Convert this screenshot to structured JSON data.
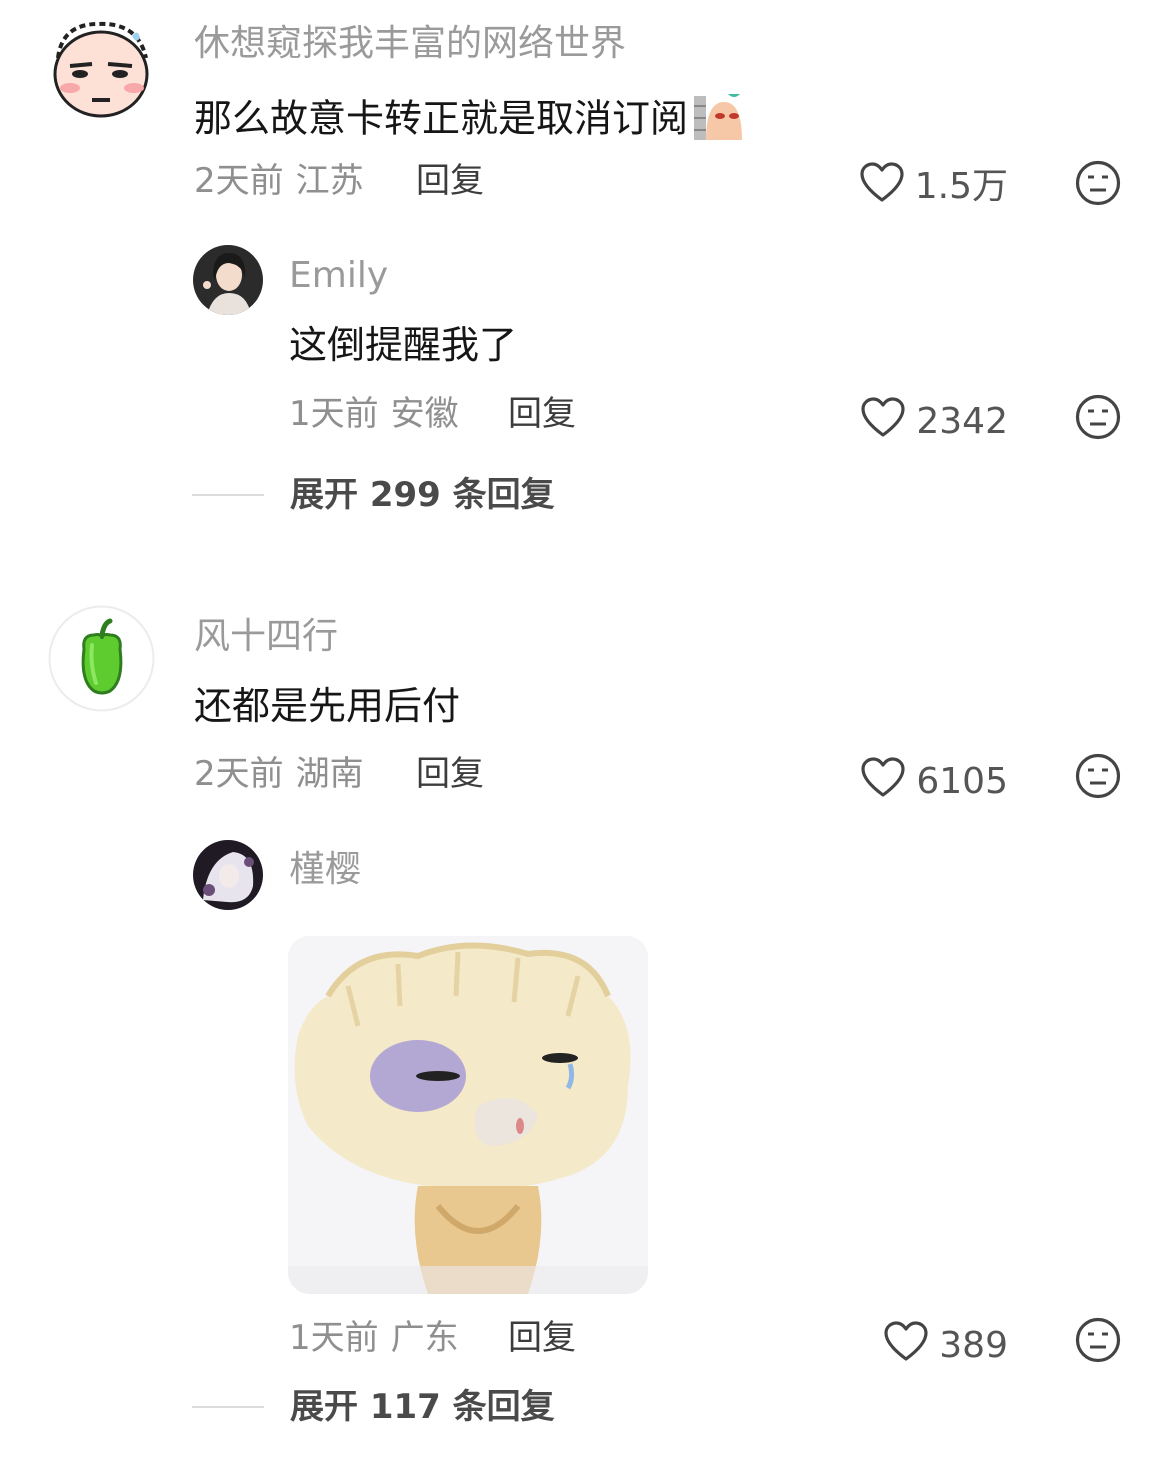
{
  "comments": [
    {
      "username": "休想窥探我丰富的网络世界",
      "text": "那么故意卡转正就是取消订阅",
      "time": "2天前",
      "location": "江苏",
      "reply_label": "回复",
      "likes": "1.5万",
      "replies": [
        {
          "username": "Emily",
          "text": "这倒提醒我了",
          "time": "1天前",
          "location": "安徽",
          "reply_label": "回复",
          "likes": "2342"
        }
      ],
      "expand_label": "展开 299 条回复"
    },
    {
      "username": "风十四行",
      "text": "还都是先用后付",
      "time": "2天前",
      "location": "湖南",
      "reply_label": "回复",
      "likes": "6105",
      "replies": [
        {
          "username": "槿樱",
          "image": "dumpling-sticker",
          "time": "1天前",
          "location": "广东",
          "reply_label": "回复",
          "likes": "389"
        }
      ],
      "expand_label": "展开 117 条回复"
    }
  ],
  "icons": {
    "like": "heart-outline-icon",
    "dislike": "neutral-face-icon"
  },
  "colors": {
    "username": "#9a9a9a",
    "text": "#161616",
    "meta": "#8f8f8f"
  }
}
